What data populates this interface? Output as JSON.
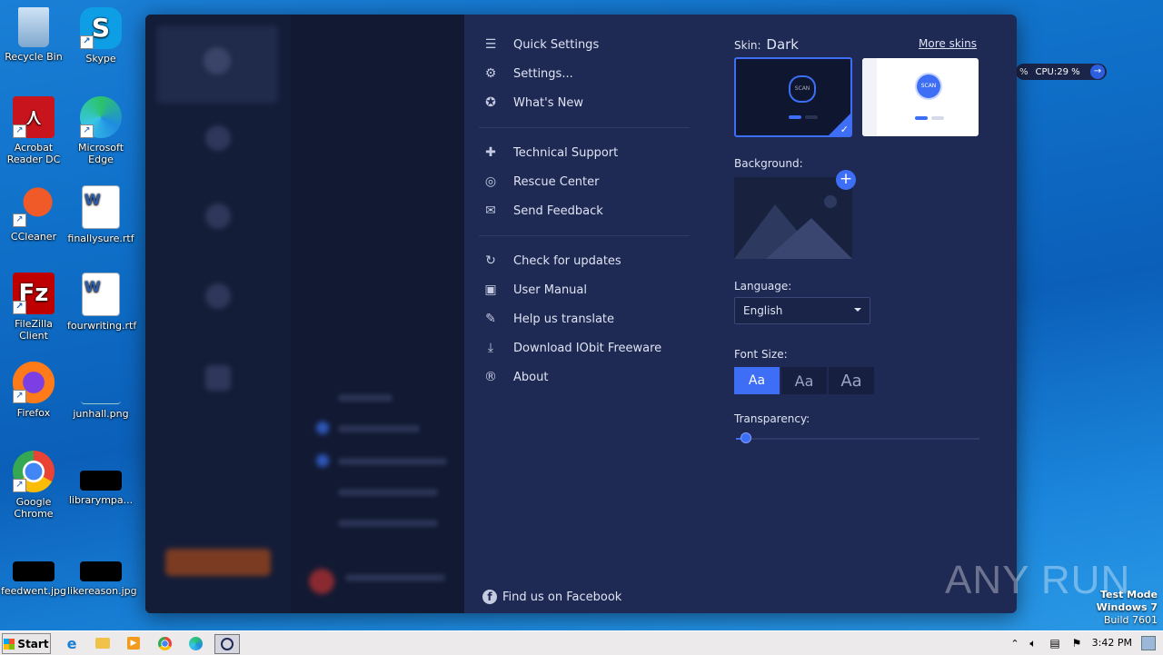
{
  "desktop": {
    "icons": [
      {
        "label": "Recycle Bin"
      },
      {
        "label": "Skype"
      },
      {
        "label": "Acrobat Reader DC"
      },
      {
        "label": "Microsoft Edge"
      },
      {
        "label": "CCleaner"
      },
      {
        "label": "finallysure.rtf"
      },
      {
        "label": "FileZilla Client"
      },
      {
        "label": "fourwriting.rtf"
      },
      {
        "label": "Firefox"
      },
      {
        "label": "junhall.png"
      },
      {
        "label": "Google Chrome"
      },
      {
        "label": "librarympa..."
      },
      {
        "label": "feedwent.jpg"
      },
      {
        "label": "likereason.jpg"
      }
    ],
    "cpu_widget": "CPU:29 %",
    "cpu_prefix": "%",
    "watermark": "ANY RUN",
    "test_mode": {
      "line1": "Test Mode",
      "line2": "Windows 7",
      "line3": "Build 7601"
    }
  },
  "menu": {
    "group1": [
      {
        "label": "Quick Settings",
        "icon": "toggle-icon"
      },
      {
        "label": "Settings...",
        "icon": "gear-icon"
      },
      {
        "label": "What's New",
        "icon": "star-icon"
      }
    ],
    "group2": [
      {
        "label": "Technical Support",
        "icon": "support-icon"
      },
      {
        "label": "Rescue Center",
        "icon": "lifebuoy-icon"
      },
      {
        "label": "Send Feedback",
        "icon": "mail-icon"
      }
    ],
    "group3": [
      {
        "label": "Check for updates",
        "icon": "refresh-icon"
      },
      {
        "label": "User Manual",
        "icon": "book-icon"
      },
      {
        "label": "Help us translate",
        "icon": "pencil-icon"
      },
      {
        "label": "Download IObit Freeware",
        "icon": "download-icon"
      },
      {
        "label": "About",
        "icon": "registered-icon"
      }
    ],
    "facebook": "Find us on Facebook"
  },
  "settings": {
    "skin_label": "Skin:",
    "skin_value": "Dark",
    "more_skins": "More skins",
    "skin_thumb_text": "SCAN",
    "background_label": "Background:",
    "language_label": "Language:",
    "language_value": "English",
    "font_size_label": "Font Size:",
    "font_sizes": [
      "Aa",
      "Aa",
      "Aa"
    ],
    "font_size_selected": 0,
    "transparency_label": "Transparency:",
    "transparency_value": 0.04
  },
  "taskbar": {
    "start": "Start",
    "clock": "3:42 PM"
  },
  "colors": {
    "accent": "#3d6ef5",
    "menu_bg": "#1e2954",
    "text": "#dfe4f3"
  }
}
